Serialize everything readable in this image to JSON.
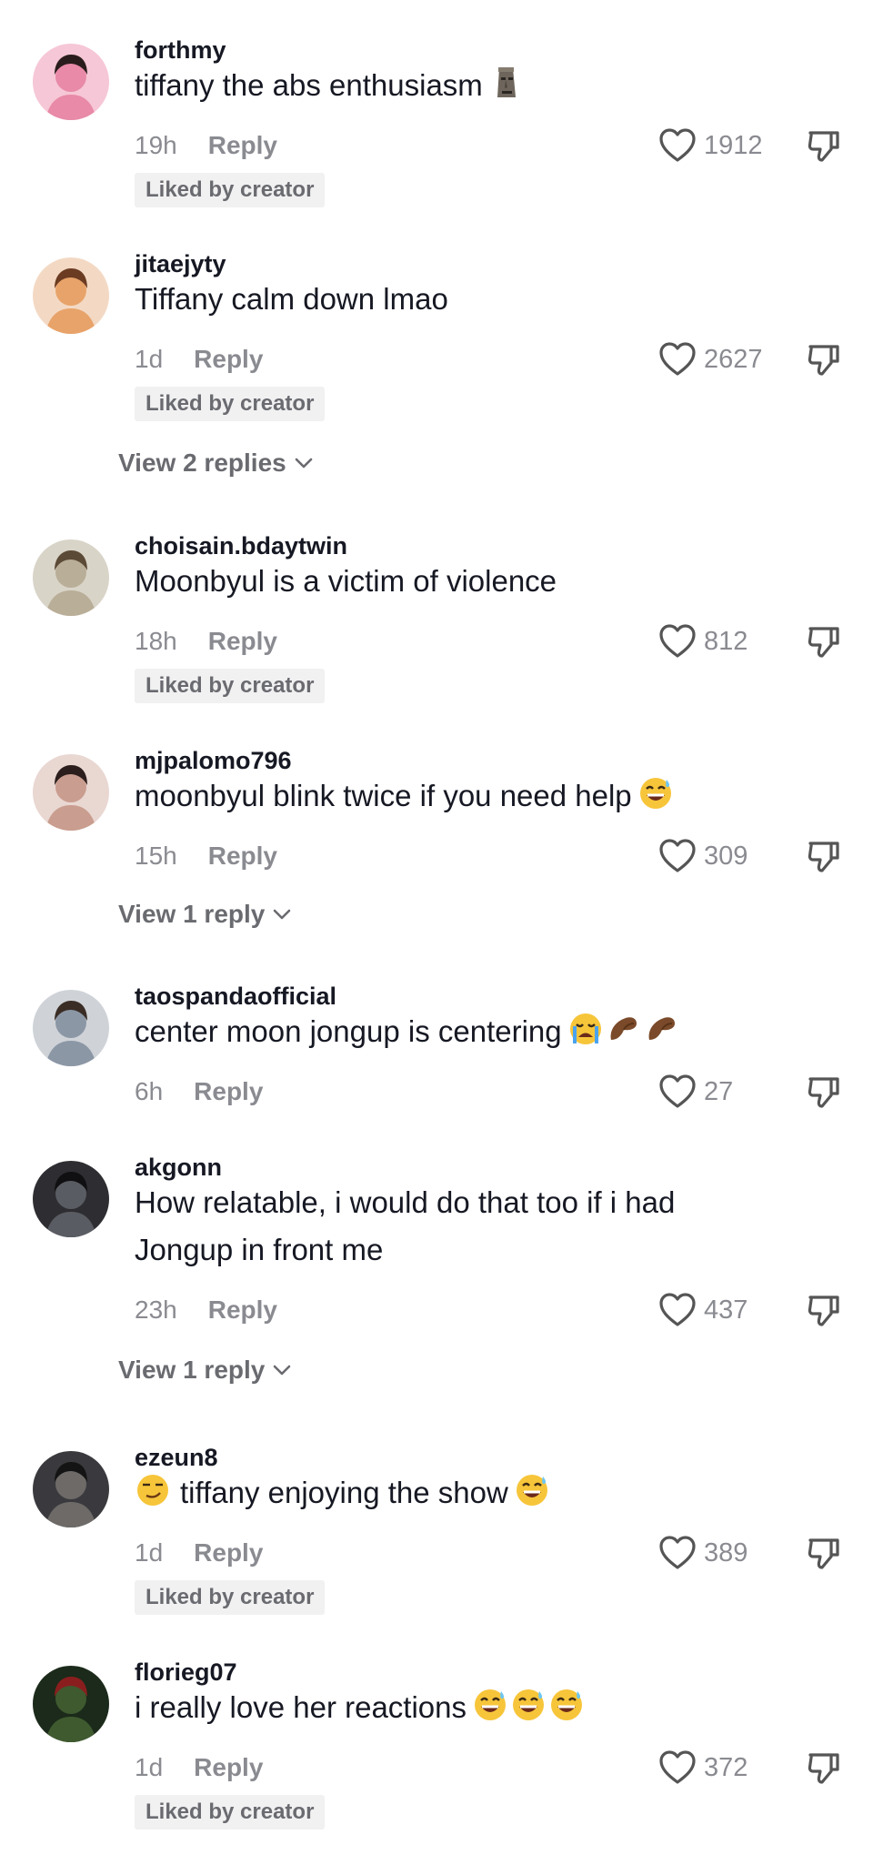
{
  "icons": {
    "like": "heart-outline-icon",
    "dislike": "thumbs-down-outline-icon",
    "expand": "chevron-down-icon"
  },
  "colors": {
    "text": "#161823",
    "muted": "#8a8b91",
    "badge_bg": "#f1f1f2"
  },
  "comments": [
    {
      "username": "forthmy",
      "text": "tiffany the abs enthusiasm",
      "emojis": [
        "moai"
      ],
      "time": "19h",
      "reply": "Reply",
      "likes": "1912",
      "badge": "Liked by creator"
    },
    {
      "username": "jitaejyty",
      "text": "Tiffany calm down lmao",
      "emojis": [],
      "time": "1d",
      "reply": "Reply",
      "likes": "2627",
      "badge": "Liked by creator",
      "view_replies": "View 2 replies"
    },
    {
      "username": "choisain.bdaytwin",
      "text": "Moonbyul is a victim of violence",
      "emojis": [],
      "time": "18h",
      "reply": "Reply",
      "likes": "812",
      "badge": "Liked by creator"
    },
    {
      "username": "mjpalomo796",
      "text": "moonbyul blink twice if you need help",
      "emojis": [
        "grin-sweat"
      ],
      "time": "15h",
      "reply": "Reply",
      "likes": "309",
      "view_replies": "View 1 reply"
    },
    {
      "username": "taospandaofficial",
      "text": "center moon jongup is centering",
      "emojis": [
        "crying",
        "pinch",
        "pinch"
      ],
      "time": "6h",
      "reply": "Reply",
      "likes": "27"
    },
    {
      "username": "akgonn",
      "text_line1": "How relatable, i would do that too if i had",
      "text_line2": "Jongup in front me",
      "emojis": [],
      "time": "23h",
      "reply": "Reply",
      "likes": "437",
      "view_replies": "View 1 reply"
    },
    {
      "username": "ezeun8",
      "text": "tiffany enjoying the show",
      "emojis_before": [
        "smirk"
      ],
      "emojis": [
        "grin-sweat"
      ],
      "time": "1d",
      "reply": "Reply",
      "likes": "389",
      "badge": "Liked by creator"
    },
    {
      "username": "florieg07",
      "text": "i really love her reactions",
      "emojis": [
        "grin-sweat",
        "grin-sweat",
        "grin-sweat"
      ],
      "time": "1d",
      "reply": "Reply",
      "likes": "372",
      "badge": "Liked by creator"
    }
  ]
}
